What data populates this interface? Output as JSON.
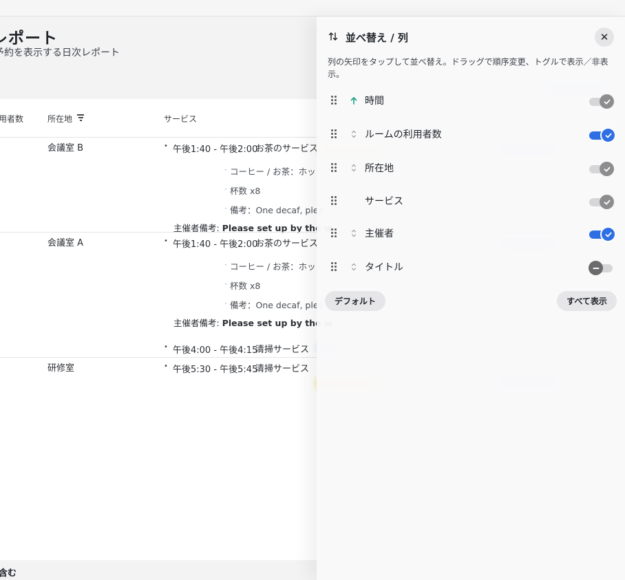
{
  "report": {
    "title": "レポート",
    "subtitle": "予約を表示する日次レポート",
    "columns": {
      "users": "用者数",
      "location": "所在地",
      "service": "サービス"
    },
    "rows": [
      {
        "location": "会議室 B",
        "time": "午後1:40 - 午後2:00",
        "service_name": "お茶のサービス",
        "details": [
          "コーヒー / お茶：ホッ",
          "杯数 x8",
          "備考：One decaf, plea"
        ],
        "host_note_label": "主催者備考: ",
        "host_note": "Please set up by the w"
      },
      {
        "location": "会議室 A",
        "time": "午後1:40 - 午後2:00",
        "service_name": "お茶のサービス",
        "details": [
          "コーヒー / お茶：ホッ",
          "杯数 x8",
          "備考：One decaf, plea"
        ],
        "host_note_label": "主催者備考: ",
        "host_note": "Please set up by the w",
        "extra_time": "午後4:00 - 午後4:15",
        "extra_service": "清掃サービス"
      },
      {
        "location": "研修室",
        "time": "午後5:30 - 午後5:45",
        "service_name": "清掃サービス"
      }
    ],
    "footer": "含む"
  },
  "panel": {
    "title": "並べ替え / 列",
    "description": "列の矢印をタップして並べ替え。ドラッグで順序変更、トグルで表示／非表示。",
    "items": [
      {
        "label": "時間",
        "sort": "asc",
        "state": "locked"
      },
      {
        "label": "ルームの利用者数",
        "sort": "none",
        "state": "on"
      },
      {
        "label": "所在地",
        "sort": "none",
        "state": "locked"
      },
      {
        "label": "サービス",
        "sort": "hidden",
        "state": "locked"
      },
      {
        "label": "主催者",
        "sort": "none",
        "state": "on"
      },
      {
        "label": "タイトル",
        "sort": "none",
        "state": "off"
      }
    ],
    "default_button": "デフォルト",
    "show_all_button": "すべて表示",
    "close_icon": "close-icon",
    "accent_color": "#2f6fe4",
    "sort_active_color": "#14a085"
  }
}
